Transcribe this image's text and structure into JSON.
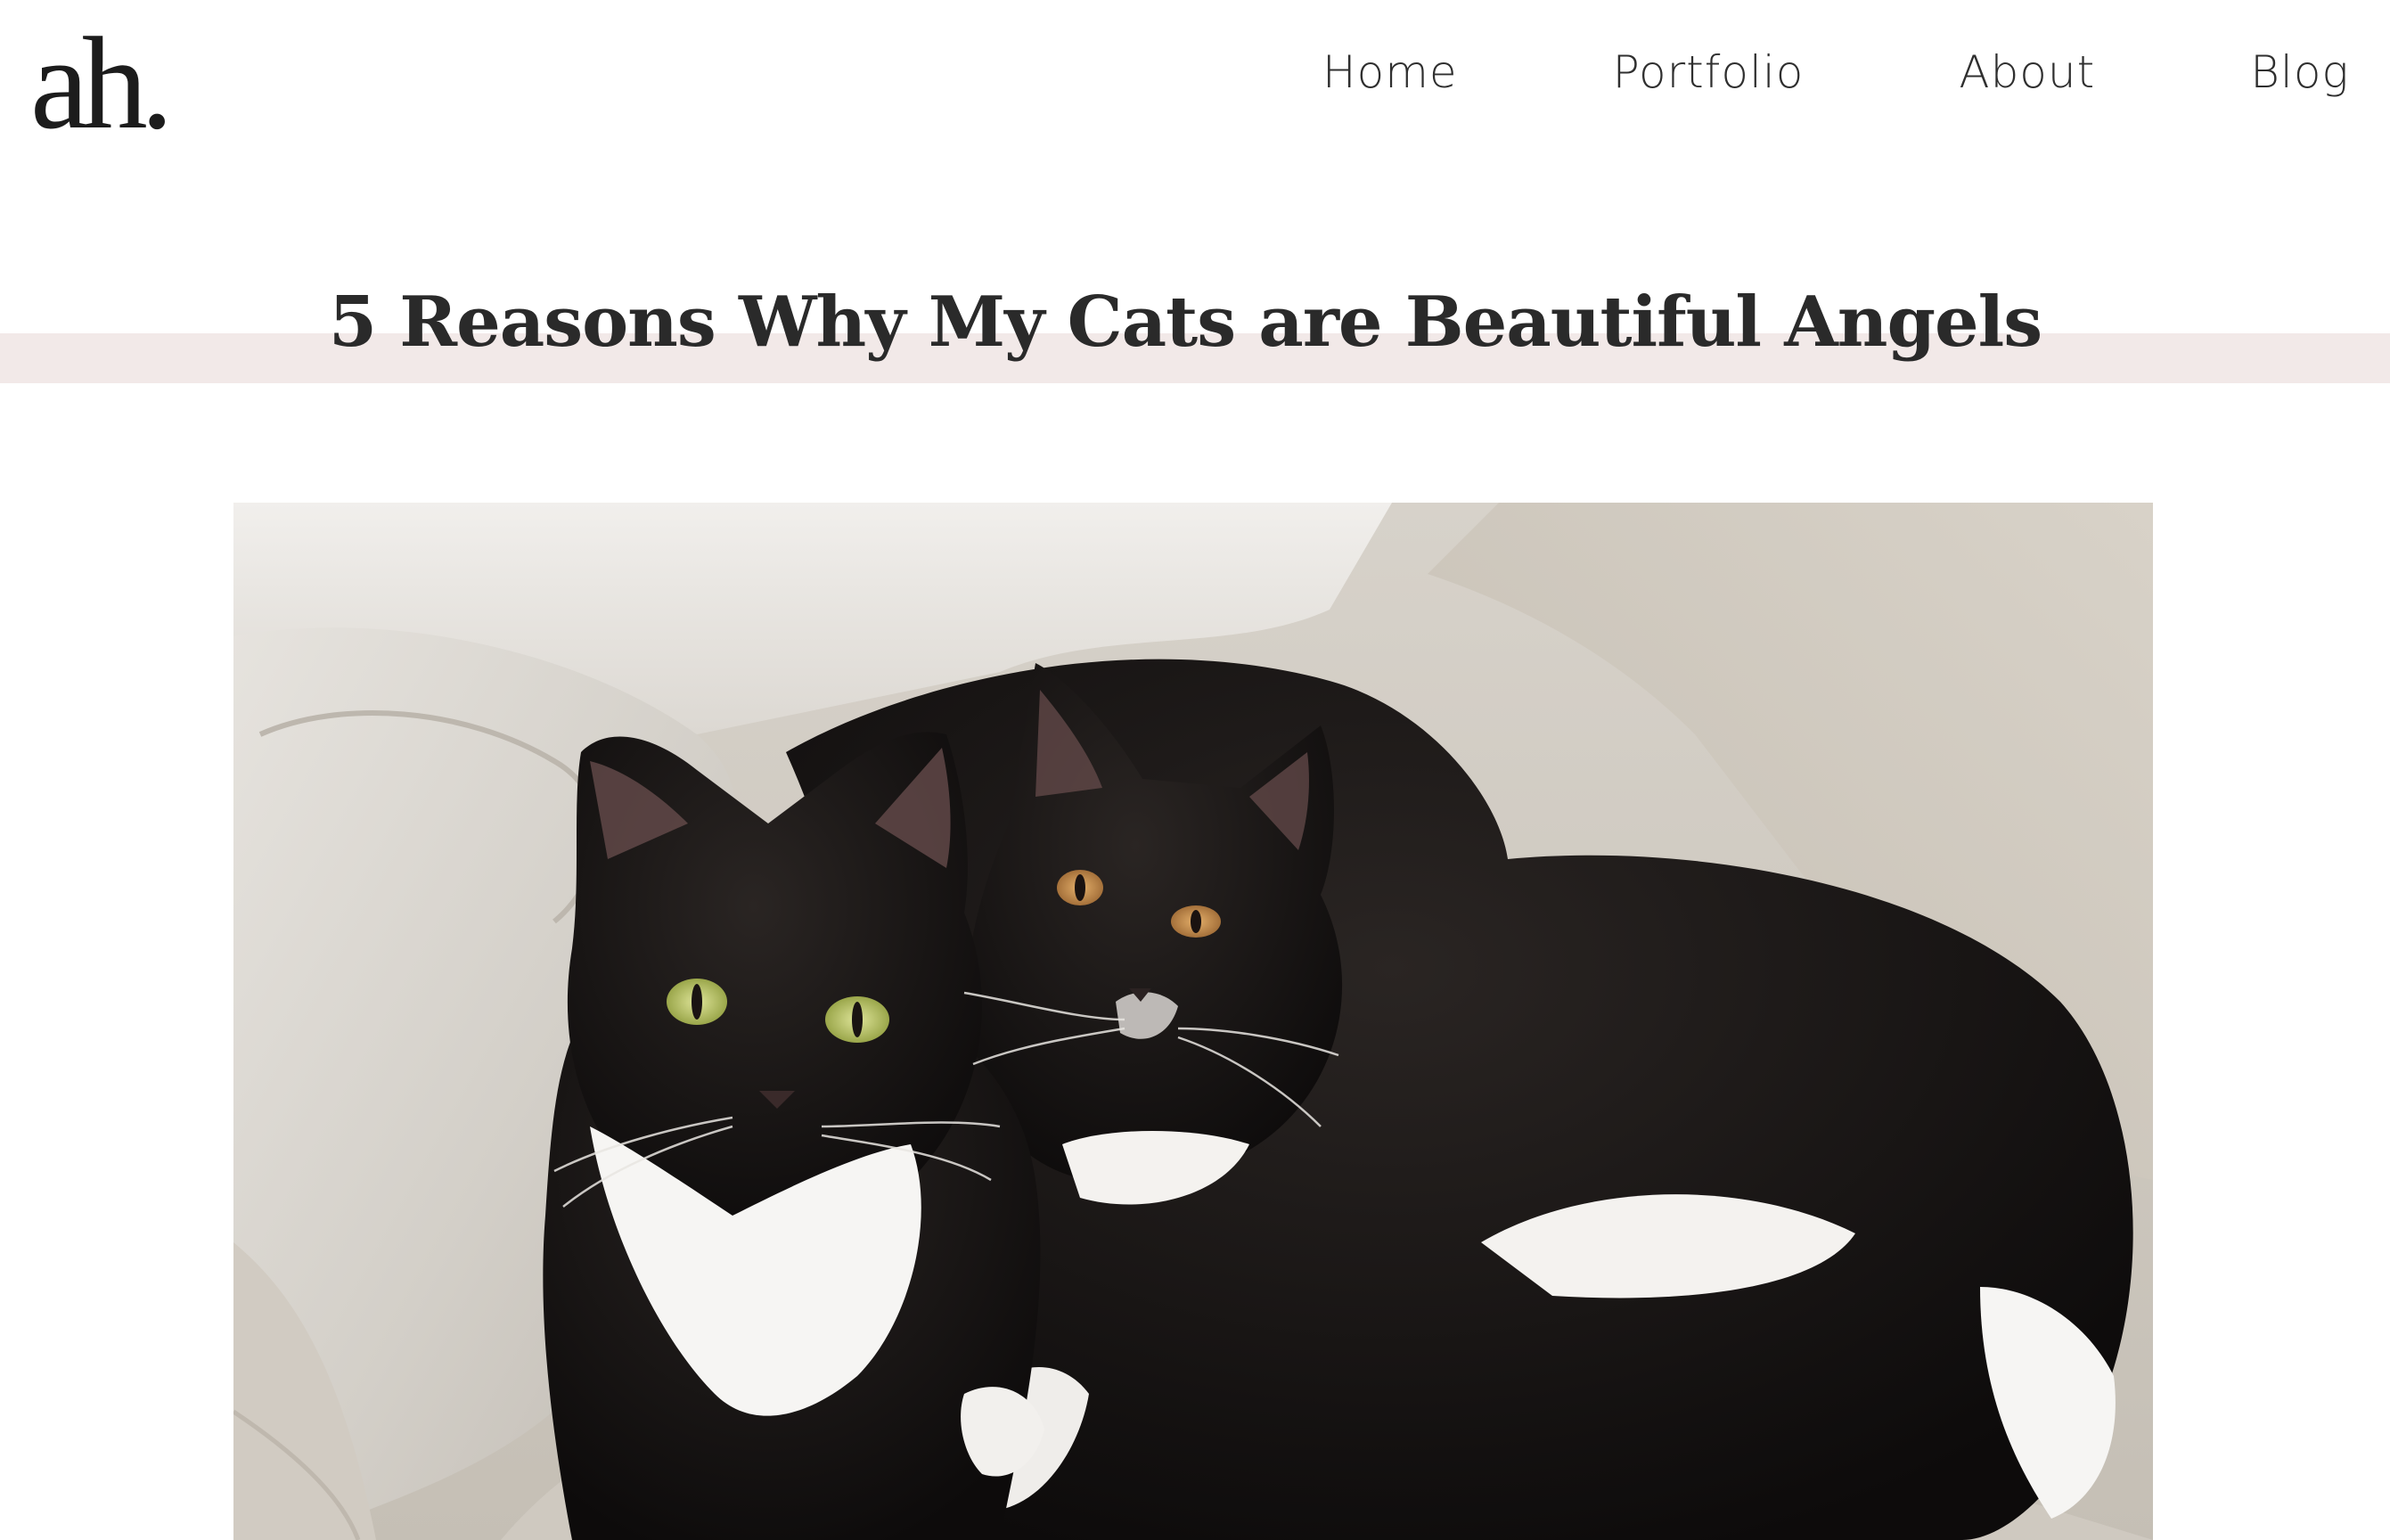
{
  "header": {
    "logo_text": "ah.",
    "nav": [
      {
        "label": "Home"
      },
      {
        "label": "Portfolio"
      },
      {
        "label": "About"
      },
      {
        "label": "Blog"
      }
    ]
  },
  "post": {
    "title": "5 Reasons Why My Cats are Beautiful Angels",
    "hero_image": {
      "subject": "two black-and-white tuxedo cats on a linen armchair"
    }
  },
  "colors": {
    "title_band": "#f2e9e8",
    "text": "#2a2a2a",
    "background": "#ffffff"
  }
}
